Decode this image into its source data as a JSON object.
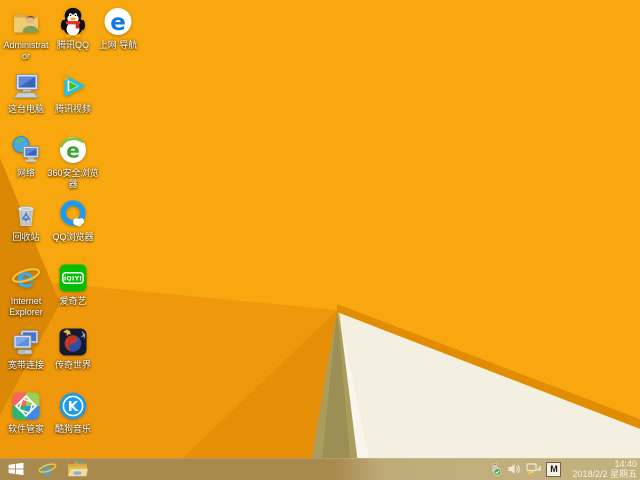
{
  "wallpaper": {
    "base": "#F8A80E",
    "fold_medium": "#F0980C",
    "fold_dark": "#E68E06",
    "fold_left": "#DA8806",
    "fold_edge": "#E18C02",
    "shadow_olive": "#AB9C5E",
    "paper_white": "#F3F0E2"
  },
  "desktop": {
    "icons": [
      {
        "id": "administrator",
        "label": "Administrator"
      },
      {
        "id": "tencent-qq",
        "label": "腾讯QQ"
      },
      {
        "id": "web-navigation",
        "label": "上网 导航"
      },
      {
        "id": "this-pc",
        "label": "这台电脑"
      },
      {
        "id": "tencent-video",
        "label": "腾讯视频"
      },
      {
        "id": "network",
        "label": "网络"
      },
      {
        "id": "360-safe-browser",
        "label": "360安全浏览器"
      },
      {
        "id": "recycle-bin",
        "label": "回收站"
      },
      {
        "id": "qq-browser",
        "label": "QQ浏览器"
      },
      {
        "id": "internet-explorer",
        "label": "Internet Explorer"
      },
      {
        "id": "iqiyi",
        "label": "爱奇艺"
      },
      {
        "id": "broadband-connection",
        "label": "宽带连接"
      },
      {
        "id": "legend-world",
        "label": "传奇世界"
      },
      {
        "id": "software-manager",
        "label": "软件管家"
      },
      {
        "id": "kugou-music",
        "label": "酷狗音乐"
      }
    ],
    "logo_glyphs": {
      "nav_e": "e",
      "browser360_e": "e",
      "ie_e": "e",
      "iqiyi": "iQIYI",
      "kugou": "K"
    }
  },
  "taskbar": {
    "color_left": "#A8894E",
    "color_right": "#C3B281",
    "buttons": [
      {
        "id": "start-button"
      },
      {
        "id": "internet-explorer-taskbar"
      },
      {
        "id": "file-explorer-taskbar"
      }
    ],
    "tray": {
      "icons": [
        {
          "id": "usb-safely-remove"
        },
        {
          "id": "volume"
        },
        {
          "id": "network-limited"
        },
        {
          "id": "input-method",
          "label": "M"
        }
      ],
      "clock": {
        "time": "14:40",
        "date": "2018/2/2 星期五"
      }
    }
  }
}
